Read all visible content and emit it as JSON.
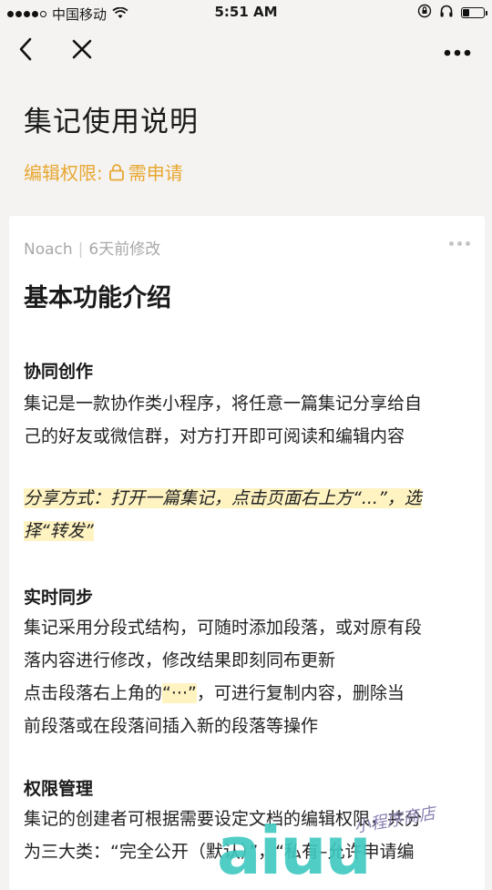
{
  "status": {
    "carrier": "中国移动",
    "time": "5:51 AM",
    "signal_bars": 4,
    "battery_level": 0.3
  },
  "nav": {
    "back_icon": "chevron-left-icon",
    "close_icon": "close-icon",
    "more_icon": "more-horizontal-icon"
  },
  "doc": {
    "title": "集记使用说明",
    "permission_label": "编辑权限:",
    "permission_value": "需申请",
    "accent_color": "#e8a732"
  },
  "card": {
    "author": "Noach",
    "modified": "6天前修改",
    "heading": "基本功能介绍",
    "sections": [
      {
        "title": "协同创作",
        "body_lines": [
          "集记是一款协作类小程序，将任意一篇集记分享给自",
          "己的好友或微信群，对方打开即可阅读和编辑内容"
        ]
      },
      {
        "highlight_lines": [
          "分享方式：打开一篇集记，点击页面右上方“...”，选",
          "择“转发”"
        ]
      },
      {
        "title": "实时同步",
        "body_lines": [
          "集记采用分段式结构，可随时添加段落，或对原有段",
          "落内容进行修改，修改结果即刻同布更新"
        ],
        "tip_prefix": "点击段落右上角的",
        "tip_highlight": "“···”",
        "tip_suffix": "，可进行复制内容，删除当",
        "tip_line2": "前段落或在段落间插入新的段落等操作"
      },
      {
        "title": "权限管理",
        "body_lines": [
          "集记的创建者可根据需要设定文档的编辑权限，共分",
          "为三大类：“完全公开（默认）”，“私有–允许申请编"
        ]
      }
    ]
  },
  "watermark": {
    "letters": "aiuu",
    "script": "小程序商店"
  }
}
